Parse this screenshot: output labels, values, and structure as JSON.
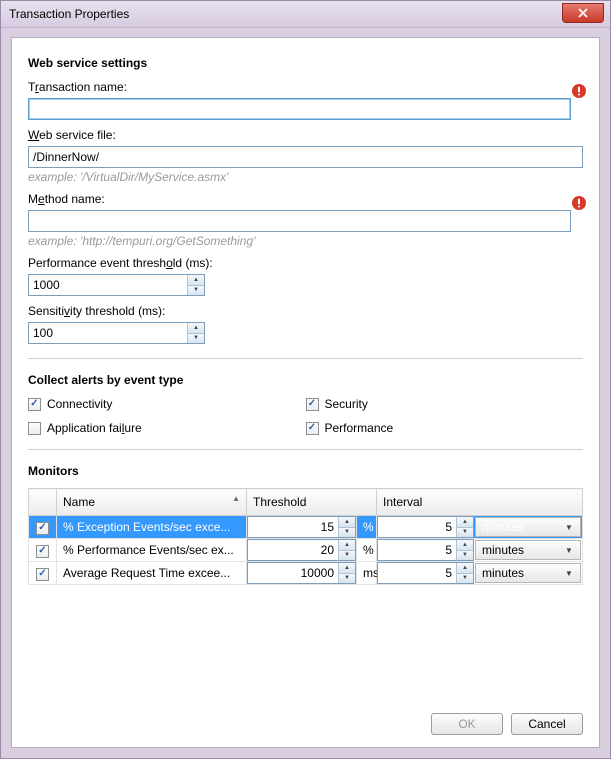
{
  "window": {
    "title": "Transaction Properties"
  },
  "sections": {
    "web_service_settings": "Web service settings",
    "collect_alerts": "Collect alerts by event type",
    "monitors": "Monitors"
  },
  "fields": {
    "transaction_name": {
      "label_pre": "T",
      "label_u": "r",
      "label_post": "ansaction name:",
      "value": ""
    },
    "web_service_file": {
      "label_pre": "",
      "label_u": "W",
      "label_post": "eb service file:",
      "value": "/DinnerNow/",
      "hint": "example: '/VirtualDir/MyService.asmx'"
    },
    "method_name": {
      "label_pre": "M",
      "label_u": "e",
      "label_post": "thod name:",
      "value": "",
      "hint": "example: 'http://tempuri.org/GetSomething'"
    },
    "perf_threshold": {
      "label_pre": "Performance event thresh",
      "label_u": "o",
      "label_post": "ld (ms):",
      "value": "1000"
    },
    "sensitivity": {
      "label_pre": "Sensiti",
      "label_u": "v",
      "label_post": "ity threshold (ms):",
      "value": "100"
    }
  },
  "alerts": {
    "connectivity": {
      "label": "Connectivity",
      "checked": true
    },
    "application_failure": {
      "label_pre": "Application fai",
      "label_u": "l",
      "label_post": "ure",
      "checked": false
    },
    "security": {
      "label": "Security",
      "checked": true
    },
    "performance": {
      "label": "Performance",
      "checked": true
    }
  },
  "monitors_table": {
    "headers": {
      "name": "Name",
      "threshold": "Threshold",
      "interval": "Interval"
    },
    "unit_options": [
      "minutes"
    ],
    "rows": [
      {
        "checked": true,
        "name": "% Exception Events/sec exce...",
        "threshold": "15",
        "threshold_unit": "%",
        "interval": "5",
        "interval_unit": "minutes",
        "selected": true
      },
      {
        "checked": true,
        "name": "% Performance Events/sec ex...",
        "threshold": "20",
        "threshold_unit": "%",
        "interval": "5",
        "interval_unit": "minutes",
        "selected": false
      },
      {
        "checked": true,
        "name": "Average Request Time excee...",
        "threshold": "10000",
        "threshold_unit": "ms",
        "interval": "5",
        "interval_unit": "minutes",
        "selected": false
      }
    ]
  },
  "buttons": {
    "ok": "OK",
    "cancel": "Cancel"
  }
}
